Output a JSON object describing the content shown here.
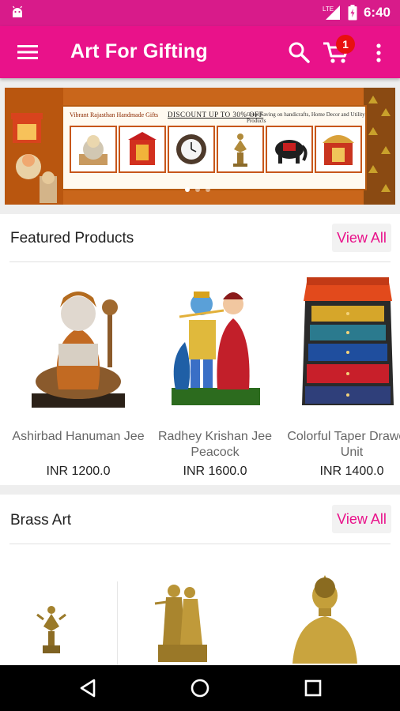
{
  "status_bar": {
    "time": "6:40",
    "network": "LTE",
    "icons": [
      "android-icon",
      "signal-icon",
      "battery-icon"
    ]
  },
  "app_bar": {
    "title": "Art For Gifting",
    "cart_count": "1",
    "icons": [
      "menu-icon",
      "search-icon",
      "cart-icon",
      "overflow-menu-icon"
    ]
  },
  "banner": {
    "line1": "Vibrant Rajasthan Handmade Gifts",
    "line2": "DISCOUNT UP TO 30% OFF",
    "line3": "Great Saving on handicrafts, Home Decor and Utility Products",
    "active_slide": 1,
    "slide_count": 3
  },
  "featured": {
    "title": "Featured Products",
    "view_all": "View All",
    "products": [
      {
        "name": "Ashirbad Hanuman Jee",
        "price": "INR 1200.0"
      },
      {
        "name": "Radhey Krishan Jee Peacock",
        "price": "INR 1600.0"
      },
      {
        "name": "Colorful Taper Drawers Unit",
        "price": "INR 1400.0"
      }
    ]
  },
  "brass": {
    "title": "Brass Art",
    "view_all": "View All"
  },
  "colors": {
    "status_bar": "#d81b8a",
    "app_bar": "#e9128a",
    "accent": "#e9128a",
    "badge": "#e81010"
  }
}
